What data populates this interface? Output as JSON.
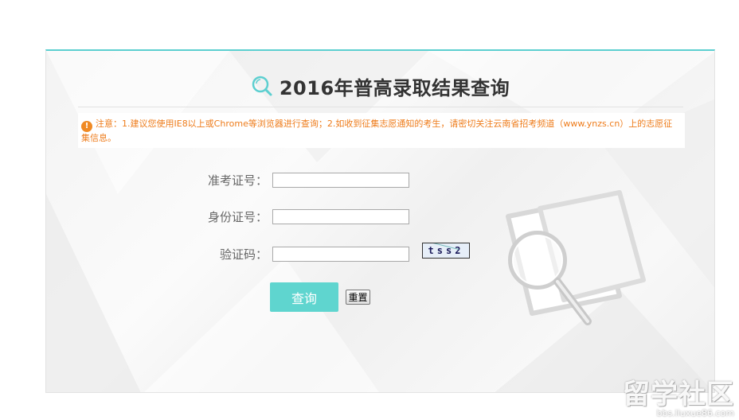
{
  "page": {
    "title": "2016年普高录取结果查询",
    "notice": "注意：1.建议您使用IE8以上或Chrome等浏览器进行查询；2.如收到征集志愿通知的考生，请密切关注云南省招考频道（www.ynzs.cn）上的志愿征集信息。"
  },
  "form": {
    "exam_no_label": "准考证号：",
    "id_no_label": "身份证号：",
    "captcha_label": "验证码：",
    "exam_no_value": "",
    "id_no_value": "",
    "captcha_value": "",
    "captcha_image_text": "tss2",
    "query_button": "查询",
    "reset_button": "重置"
  },
  "watermark": {
    "brand": "留学社区",
    "url": "bbs.liuxue86.com"
  },
  "colors": {
    "accent": "#5fd5cf",
    "panel_border": "#5ccfd0",
    "notice_text": "#ee7c1b",
    "title_text": "#333333",
    "label_text": "#666666"
  },
  "icons": {
    "title_icon": "search-icon",
    "notice_icon": "warning-icon",
    "decoration": "magnifier-illustration"
  }
}
